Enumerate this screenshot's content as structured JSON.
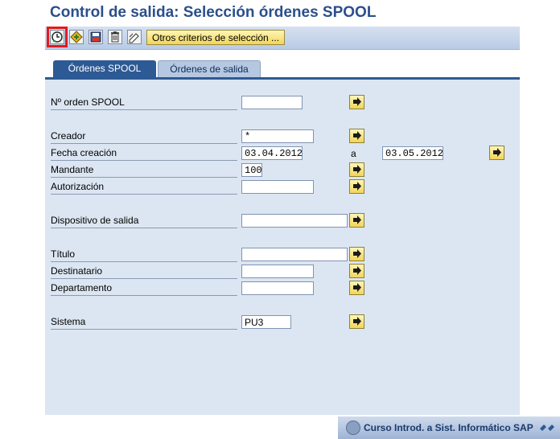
{
  "window": {
    "title": "Control de salida: Selección órdenes SPOOL"
  },
  "toolbar": {
    "execute_icon": "execute-clock-icon",
    "variant_icon": "get-variant-icon",
    "save_icon": "save-variant-icon",
    "delete_icon": "delete-icon",
    "edit_icon": "edit-icon",
    "criteria_label": "Otros criterios de selección ..."
  },
  "tabs": [
    {
      "label": "Órdenes SPOOL",
      "active": true
    },
    {
      "label": "Órdenes de salida",
      "active": false
    }
  ],
  "form": {
    "spool_no": {
      "label": "Nº orden SPOOL",
      "value": ""
    },
    "creator": {
      "label": "Creador",
      "value": "*"
    },
    "created_date": {
      "label": "Fecha creación",
      "from": "03.04.2012",
      "to_label": "a",
      "to": "03.05.2012"
    },
    "client": {
      "label": "Mandante",
      "value": "100"
    },
    "authorization": {
      "label": "Autorización",
      "value": ""
    },
    "output_device": {
      "label": "Dispositivo de salida",
      "value": ""
    },
    "title": {
      "label": "Título",
      "value": ""
    },
    "recipient": {
      "label": "Destinatario",
      "value": ""
    },
    "department": {
      "label": "Departamento",
      "value": ""
    },
    "system": {
      "label": "Sistema",
      "value": "PU3"
    }
  },
  "footer": {
    "text": "Curso Introd. a Sist. Informático SAP"
  },
  "colors": {
    "title": "#2b4f8c",
    "tab_active": "#2d5a94",
    "panel": "#dce6f2",
    "highlight": "#e21b1b"
  }
}
